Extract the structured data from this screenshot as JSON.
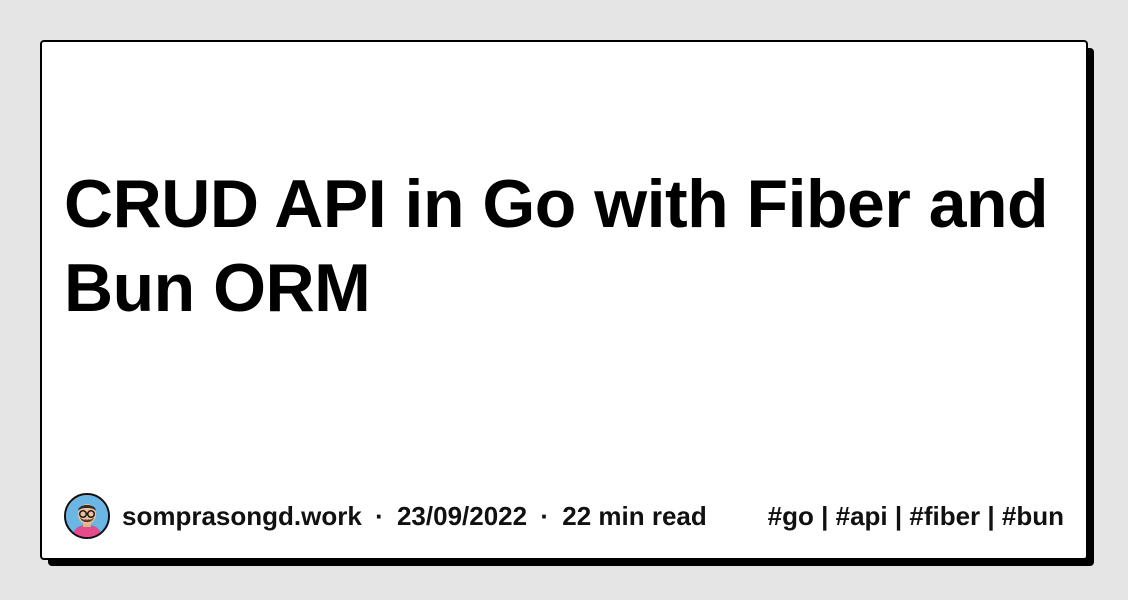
{
  "card": {
    "title": "CRUD API in Go with Fiber and Bun ORM",
    "author": "somprasongd.work",
    "separator": "·",
    "date": "23/09/2022",
    "read_time": "22 min read",
    "tags": "#go | #api | #fiber | #bun"
  },
  "colors": {
    "background": "#e5e5e5",
    "card": "#ffffff",
    "text": "#000000",
    "shadow": "#000000"
  },
  "icons": {
    "avatar": "avatar-person-glasses-icon"
  }
}
